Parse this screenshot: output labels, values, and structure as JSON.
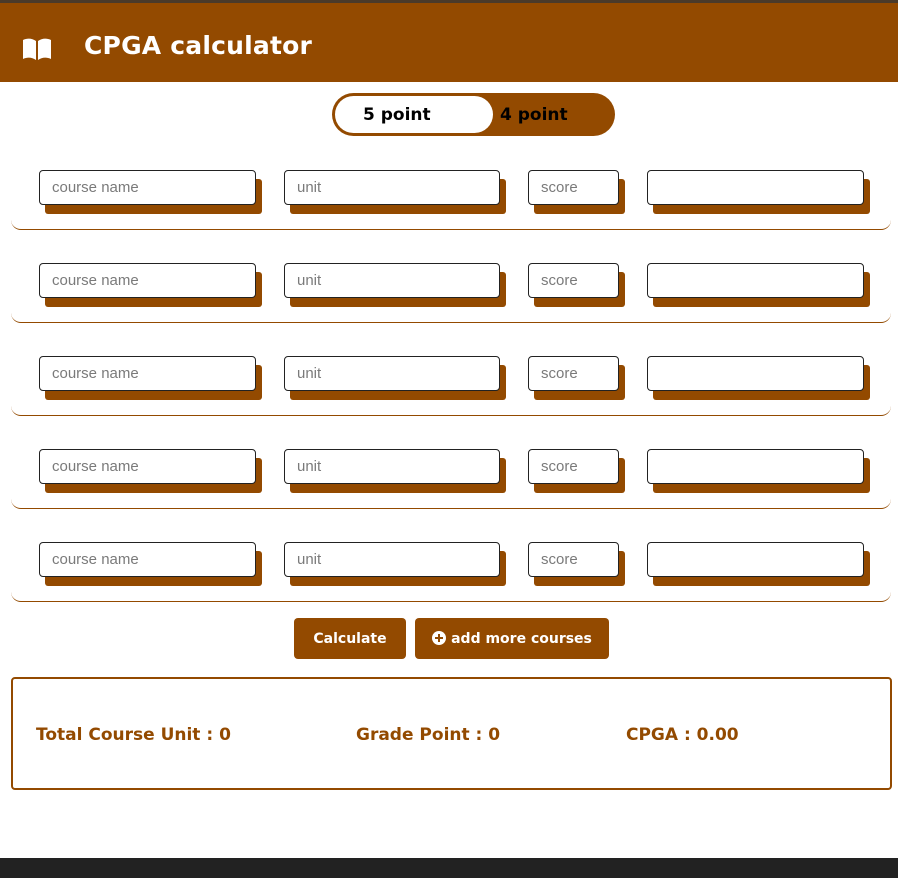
{
  "header": {
    "icon": "open-book-icon",
    "title": "CPGA calculator"
  },
  "grading_scale": {
    "options": [
      "5 point",
      "4 point"
    ],
    "selected": "5 point"
  },
  "course_rows": [
    {
      "course_name_placeholder": "course name",
      "unit_placeholder": "unit",
      "score_placeholder": "score",
      "grade_value": ""
    },
    {
      "course_name_placeholder": "course name",
      "unit_placeholder": "unit",
      "score_placeholder": "score",
      "grade_value": ""
    },
    {
      "course_name_placeholder": "course name",
      "unit_placeholder": "unit",
      "score_placeholder": "score",
      "grade_value": ""
    },
    {
      "course_name_placeholder": "course name",
      "unit_placeholder": "unit",
      "score_placeholder": "score",
      "grade_value": ""
    },
    {
      "course_name_placeholder": "course name",
      "unit_placeholder": "unit",
      "score_placeholder": "score",
      "grade_value": ""
    }
  ],
  "actions": {
    "calculate_label": "Calculate",
    "add_more_label": "add more courses",
    "add_more_icon": "plus-circle-icon"
  },
  "results": {
    "total_course_unit": "Total Course Unit : 0",
    "grade_point": "Grade Point : 0",
    "cpga": "CPGA : 0.00"
  },
  "colors": {
    "accent": "#934a00",
    "background": "#ffffff",
    "footer": "#222222"
  }
}
